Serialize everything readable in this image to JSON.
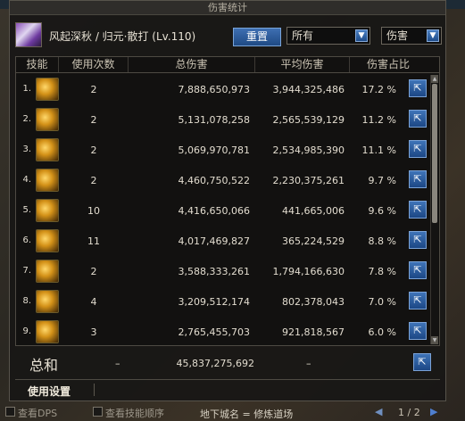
{
  "window": {
    "title": "伤害统计"
  },
  "header": {
    "character": "风起深秋 / 归元·散打 (Lv.110)",
    "reset_label": "重置",
    "filter_selected": "所有",
    "type_selected": "伤害"
  },
  "table": {
    "columns": [
      "技能",
      "使用次数",
      "总伤害",
      "平均伤害",
      "伤害占比"
    ],
    "rows": [
      {
        "index": "1.",
        "count": "2",
        "total": "7,888,650,973",
        "avg": "3,944,325,486",
        "pct": "17.2 %"
      },
      {
        "index": "2.",
        "count": "2",
        "total": "5,131,078,258",
        "avg": "2,565,539,129",
        "pct": "11.2 %"
      },
      {
        "index": "3.",
        "count": "2",
        "total": "5,069,970,781",
        "avg": "2,534,985,390",
        "pct": "11.1 %"
      },
      {
        "index": "4.",
        "count": "2",
        "total": "4,460,750,522",
        "avg": "2,230,375,261",
        "pct": "9.7 %"
      },
      {
        "index": "5.",
        "count": "10",
        "total": "4,416,650,066",
        "avg": "441,665,006",
        "pct": "9.6 %"
      },
      {
        "index": "6.",
        "count": "11",
        "total": "4,017,469,827",
        "avg": "365,224,529",
        "pct": "8.8 %"
      },
      {
        "index": "7.",
        "count": "2",
        "total": "3,588,333,261",
        "avg": "1,794,166,630",
        "pct": "7.8 %"
      },
      {
        "index": "8.",
        "count": "4",
        "total": "3,209,512,174",
        "avg": "802,378,043",
        "pct": "7.0 %"
      },
      {
        "index": "9.",
        "count": "3",
        "total": "2,765,455,703",
        "avg": "921,818,567",
        "pct": "6.0 %"
      }
    ]
  },
  "summary": {
    "label": "总和",
    "count": "–",
    "total": "45,837,275,692",
    "avg": "–"
  },
  "settings": {
    "tab_label": "使用设置"
  },
  "footer": {
    "dps_label": "查看DPS",
    "order_label": "查看技能顺序",
    "dungeon": "地下城名 = 修炼道场",
    "page": "1 / 2"
  },
  "icons": {
    "export": "export-icon",
    "dropdown": "chevron-down-icon",
    "prev": "arrow-left-icon",
    "next": "arrow-right-icon"
  },
  "colors": {
    "accent_blue": "#2f5f9e",
    "panel_bg": "#181716"
  }
}
